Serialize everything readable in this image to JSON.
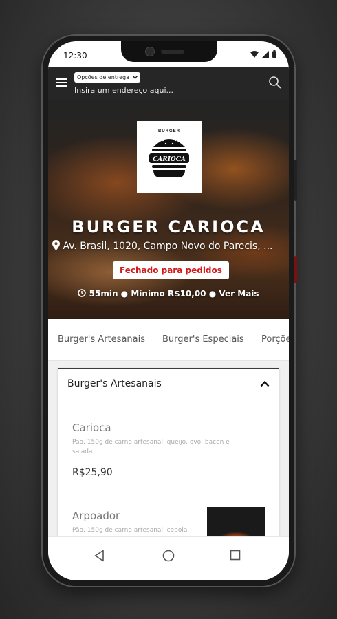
{
  "status_bar": {
    "time": "12:30"
  },
  "header": {
    "delivery_option": "Opções de entrega",
    "address_placeholder": "Insira um endereço aqui..."
  },
  "store": {
    "name": "BURGER CARIOCA",
    "address": "Av. Brasil, 1020, Campo Novo do Parecis, ...",
    "status": "Fechado para pedidos",
    "delivery_time": "55min",
    "minimum": "Mínimo R$10,00",
    "more": "Ver Mais",
    "logo_top_text": "BURGER",
    "logo_text": "CARIOCA"
  },
  "tabs": [
    "Burger's Artesanais",
    "Burger's Especiais",
    "Porções"
  ],
  "menu_section": {
    "title": "Burger's Artesanais",
    "products": [
      {
        "name": "Carioca",
        "description": "Pão, 150g de carne artesanal, queijo, ovo, bacon e salada",
        "price": "R$25,90"
      },
      {
        "name": "Arpoador",
        "description": "Pão, 150g de carne artesanal, cebola"
      }
    ]
  },
  "colors": {
    "header_bg": "#262626",
    "accent_red": "#d41a1a",
    "bg": "#f0f0f0"
  }
}
